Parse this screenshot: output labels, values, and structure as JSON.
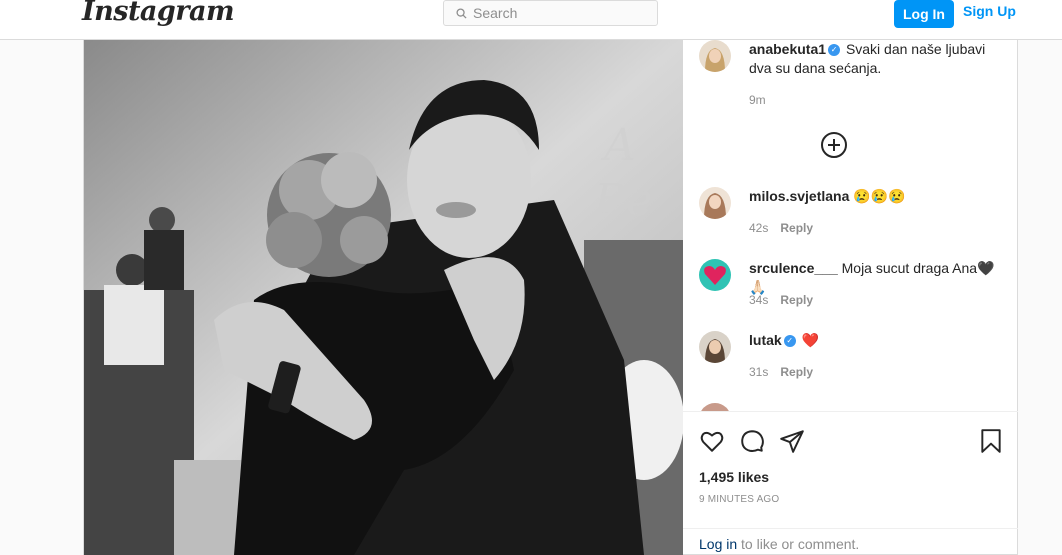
{
  "header": {
    "logo": "Instagram",
    "search_placeholder": "Search",
    "login_label": "Log In",
    "signup_label": "Sign Up"
  },
  "post": {
    "photo_description_icon": "photo",
    "caption": {
      "username": "anabekuta1",
      "verified": true,
      "text": "Svaki dan naše ljubavi dva su dana sećanja.",
      "time": "9m"
    },
    "comments": [
      {
        "username": "milos.svjetlana",
        "text": "😢😢😢",
        "time": "42s",
        "reply": "Reply",
        "avatar_color": "#c9a88a"
      },
      {
        "username": "srculence___",
        "text": "Moja sucut draga Ana🖤🙏🏻",
        "time": "34s",
        "reply": "Reply",
        "avatar_color": "#e0245e"
      },
      {
        "username": "lutak",
        "verified": true,
        "text": "❤️",
        "time": "31s",
        "reply": "Reply",
        "avatar_color": "#b9a99a"
      }
    ],
    "likes": "1,495 likes",
    "timestamp": "9 MINUTES AGO",
    "login_prompt_link": "Log in",
    "login_prompt_text": " to like or comment."
  },
  "colors": {
    "accent": "#0095f6",
    "verified": "#3897f0",
    "border": "#dbdbdb"
  }
}
